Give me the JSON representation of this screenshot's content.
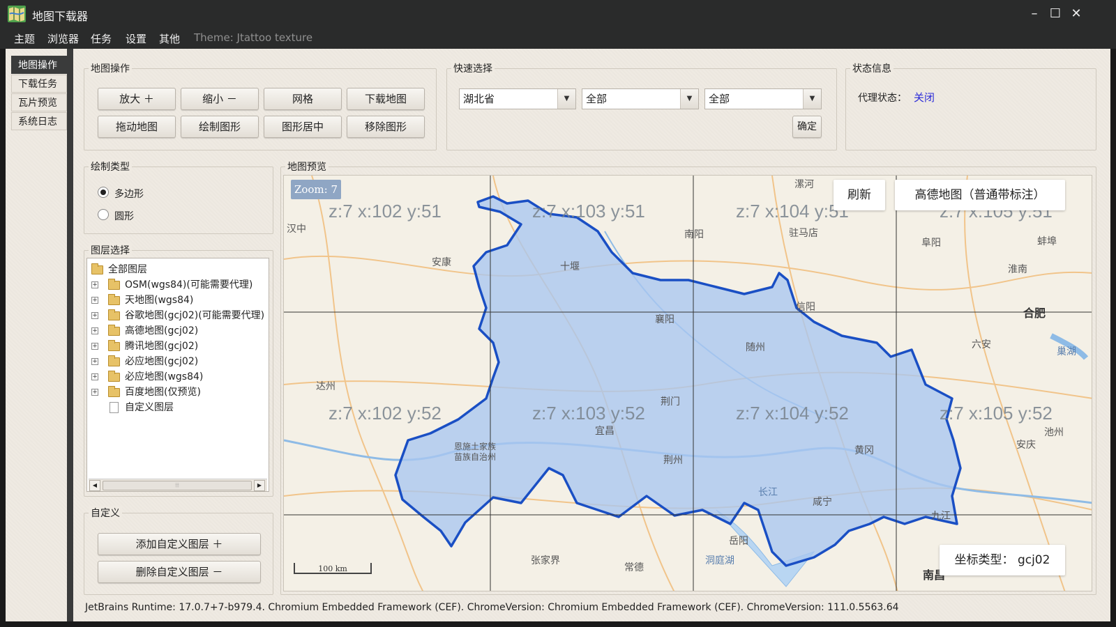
{
  "window": {
    "title": "地图下载器",
    "minimize": "–",
    "maximize": "☐",
    "close": "✕"
  },
  "menubar": {
    "items": [
      "主题",
      "浏览器",
      "任务",
      "设置",
      "其他"
    ],
    "theme": "Theme: Jtattoo texture"
  },
  "side_tabs": [
    {
      "label": "地图操作",
      "active": true
    },
    {
      "label": "下载任务",
      "active": false
    },
    {
      "label": "瓦片预览",
      "active": false
    },
    {
      "label": "系统日志",
      "active": false
    }
  ],
  "map_ops": {
    "title": "地图操作",
    "buttons": [
      "放大 ＋",
      "缩小 －",
      "网格",
      "下载地图",
      "拖动地图",
      "绘制图形",
      "图形居中",
      "移除图形"
    ]
  },
  "quick_select": {
    "title": "快速选择",
    "province": "湖北省",
    "city": "全部",
    "district": "全部",
    "confirm": "确定"
  },
  "status_info": {
    "title": "状态信息",
    "proxy_label": "代理状态：",
    "proxy_value": "关闭"
  },
  "draw_type": {
    "title": "绘制类型",
    "options": [
      {
        "label": "多边形",
        "checked": true
      },
      {
        "label": "圆形",
        "checked": false
      }
    ]
  },
  "layers": {
    "title": "图层选择",
    "root": "全部图层",
    "items": [
      "OSM(wgs84)(可能需要代理)",
      "天地图(wgs84)",
      "谷歌地图(gcj02)(可能需要代理)",
      "高德地图(gcj02)",
      "腾讯地图(gcj02)",
      "必应地图(gcj02)",
      "必应地图(wgs84)",
      "百度地图(仅预览)"
    ],
    "custom": "自定义图层"
  },
  "custom": {
    "title": "自定义",
    "add": "添加自定义图层 ＋",
    "remove": "删除自定义图层 －"
  },
  "map": {
    "title": "地图预览",
    "zoom": "Zoom: 7",
    "refresh": "刷新",
    "source": "高德地图（普通带标注）",
    "coord_type": "坐标类型：  gcj02",
    "scale": "100 km",
    "tiles": [
      "z:7 x:102 y:51",
      "z:7 x:103 y:51",
      "z:7 x:104 y:51",
      "z:7 x:105 y:51",
      "z:7 x:102 y:52",
      "z:7 x:103 y:52",
      "z:7 x:104 y:52",
      "z:7 x:105 y:52"
    ],
    "cities": [
      "汉中",
      "安康",
      "十堰",
      "南阳",
      "驻马店",
      "阜阳",
      "蚌埠",
      "淮南",
      "漯河",
      "襄阳",
      "信阳",
      "随州",
      "合肥",
      "六安",
      "巢湖",
      "达州",
      "荆门",
      "恩施土家族苗族自治州",
      "宜昌",
      "荆州",
      "黄冈",
      "安庆",
      "池州",
      "咸宁",
      "九江",
      "岳阳",
      "张家界",
      "常德",
      "洞庭湖",
      "南昌",
      "长江"
    ]
  },
  "status_bar": "JetBrains Runtime: 17.0.7+7-b979.4. Chromium Embedded Framework (CEF). ChromeVersion: Chromium Embedded Framework (CEF). ChromeVersion: 111.0.5563.64",
  "colors": {
    "accent_link": "#2b2bd8",
    "region_fill": "#a9c6f0",
    "region_stroke": "#1a4fc4",
    "dark_chrome": "#2a2b2b"
  }
}
